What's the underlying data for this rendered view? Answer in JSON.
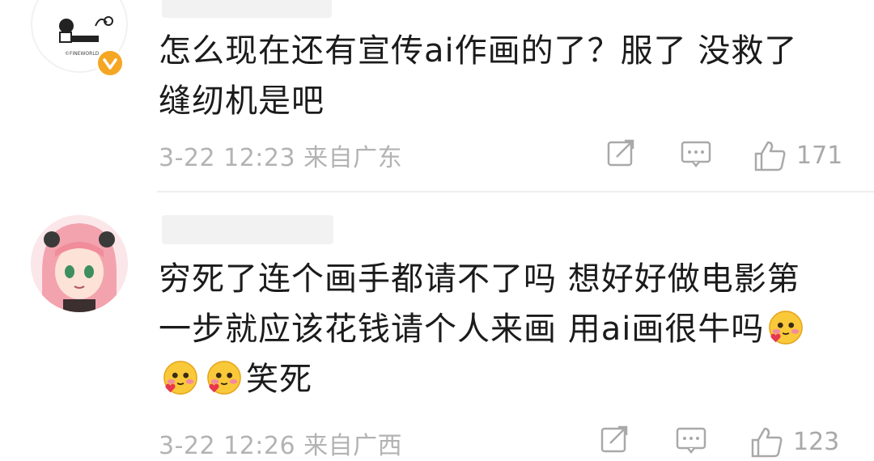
{
  "comments": [
    {
      "text_line1": "怎么现在还有宣传ai作画的了？服了 没救了",
      "text_line2": "缝纫机是吧",
      "meta": "3-22 12:23 来自广东",
      "likes": "171",
      "avatar_caption": "©FINEWORLD",
      "verified_color": "#f5a623"
    },
    {
      "text_line1": "穷死了连个画手都请不了吗 想好好做电影第",
      "text_line2": "一步就应该花钱请个人来画 用ai画很牛吗",
      "text_line3": "笑死",
      "meta": "3-22 12:26 来自广西",
      "likes": "123"
    }
  ],
  "icons": {
    "share": "share-icon",
    "reply": "comment-icon",
    "like": "thumbs-up-icon",
    "emoji": "blushing-heart-emoji"
  },
  "colors": {
    "meta_text": "#b3b3b3",
    "icon": "#a9a9a9",
    "emoji_face": "#f9c93a",
    "heart": "#e8384f"
  }
}
